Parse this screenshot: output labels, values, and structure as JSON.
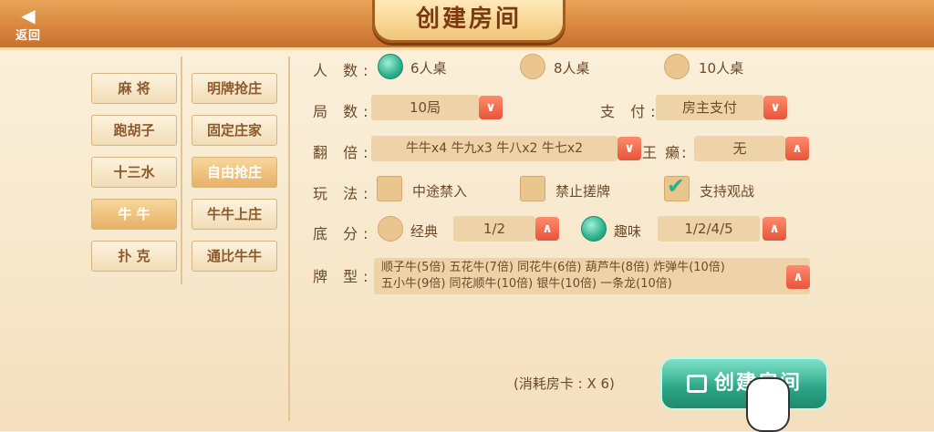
{
  "header": {
    "title": "创建房间",
    "back_label": "返回"
  },
  "categories_left": [
    {
      "label": "麻 将",
      "active": false
    },
    {
      "label": "跑胡子",
      "active": false
    },
    {
      "label": "十三水",
      "active": false
    },
    {
      "label": "牛 牛",
      "active": true
    },
    {
      "label": "扑 克",
      "active": false
    }
  ],
  "categories_right": [
    {
      "label": "明牌抢庄",
      "active": false
    },
    {
      "label": "固定庄家",
      "active": false
    },
    {
      "label": "自由抢庄",
      "active": true
    },
    {
      "label": "牛牛上庄",
      "active": false
    },
    {
      "label": "通比牛牛",
      "active": false
    }
  ],
  "form": {
    "players": {
      "label": "人 数:",
      "options": [
        "6人桌",
        "8人桌",
        "10人桌"
      ],
      "selected": "6人桌"
    },
    "rounds": {
      "label": "局 数:",
      "value": "10局"
    },
    "payment": {
      "label": "支 付:",
      "value": "房主支付"
    },
    "multiplier": {
      "label": "翻 倍:",
      "value": "牛牛x4 牛九x3 牛八x2 牛七x2"
    },
    "joker": {
      "label": "王 癞:",
      "value": "无"
    },
    "rules": {
      "label": "玩 法:",
      "options": [
        "中途禁入",
        "禁止搓牌",
        "支持观战"
      ],
      "checked": [
        "支持观战"
      ]
    },
    "base_score": {
      "label": "底 分:",
      "classic_label": "经典",
      "classic_value": "1/2",
      "fun_label": "趣味",
      "fun_value": "1/2/4/5",
      "selected": "趣味"
    },
    "card_types": {
      "label": "牌 型:",
      "line1": "顺子牛(5倍) 五花牛(7倍) 同花牛(6倍) 葫芦牛(8倍) 炸弹牛(10倍)",
      "line2": "五小牛(9倍) 同花顺牛(10倍) 银牛(10倍) 一条龙(10倍)"
    }
  },
  "footer": {
    "cost_text": "(消耗房卡 : X 6)",
    "create_label": "创建房间"
  },
  "colors": {
    "accent": "#2aa585",
    "topbar": "#d7843d",
    "dropdown": "#e7553b"
  },
  "icons": {
    "back": "back-arrow-icon",
    "dropdown": "chevron-icon",
    "create": "room-icon",
    "pointer": "hand-pointer-icon"
  }
}
